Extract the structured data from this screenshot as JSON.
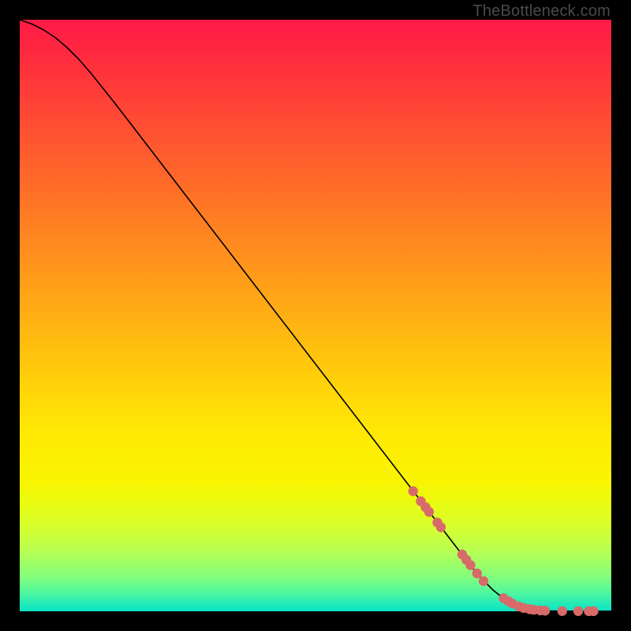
{
  "watermark": "TheBottleneck.com",
  "chart_data": {
    "type": "line",
    "title": "",
    "xlabel": "",
    "ylabel": "",
    "xlim": [
      0,
      100
    ],
    "ylim": [
      0,
      100
    ],
    "grid": false,
    "series": [
      {
        "name": "curve",
        "color": "#000000",
        "stroke_width": 1.6,
        "x": [
          0,
          2,
          4,
          6,
          8,
          10,
          12,
          14,
          16,
          20,
          30,
          40,
          50,
          60,
          70,
          74,
          76,
          78,
          80,
          82,
          84,
          86,
          88,
          90,
          92,
          94,
          96,
          98,
          100
        ],
        "y": [
          100,
          99.3,
          98.3,
          97.0,
          95.3,
          93.3,
          91.0,
          88.5,
          86.0,
          80.8,
          67.8,
          54.8,
          41.8,
          28.8,
          15.8,
          10.6,
          8.0,
          5.6,
          3.6,
          2.0,
          1.0,
          0.4,
          0.1,
          0.05,
          0.03,
          0.02,
          0.015,
          0.01,
          0.01
        ]
      }
    ],
    "markers": [
      {
        "name": "points-on-curve",
        "color": "#d86a6a",
        "radius": 6.2,
        "points": [
          {
            "x": 66.5,
            "y": 20.3
          },
          {
            "x": 67.8,
            "y": 18.6
          },
          {
            "x": 68.6,
            "y": 17.6
          },
          {
            "x": 69.2,
            "y": 16.8
          },
          {
            "x": 70.6,
            "y": 15.0
          },
          {
            "x": 71.2,
            "y": 14.2
          },
          {
            "x": 74.8,
            "y": 9.6
          },
          {
            "x": 75.5,
            "y": 8.7
          },
          {
            "x": 76.2,
            "y": 7.8
          },
          {
            "x": 77.3,
            "y": 6.4
          },
          {
            "x": 78.4,
            "y": 5.1
          },
          {
            "x": 81.8,
            "y": 2.2
          },
          {
            "x": 82.6,
            "y": 1.7
          },
          {
            "x": 83.3,
            "y": 1.3
          },
          {
            "x": 84.4,
            "y": 0.8
          },
          {
            "x": 85.2,
            "y": 0.55
          },
          {
            "x": 86.2,
            "y": 0.35
          },
          {
            "x": 86.9,
            "y": 0.25
          },
          {
            "x": 88.0,
            "y": 0.15
          },
          {
            "x": 88.8,
            "y": 0.1
          },
          {
            "x": 91.7,
            "y": 0.04
          },
          {
            "x": 94.4,
            "y": 0.03
          },
          {
            "x": 96.2,
            "y": 0.02
          },
          {
            "x": 97.0,
            "y": 0.02
          }
        ]
      }
    ]
  }
}
